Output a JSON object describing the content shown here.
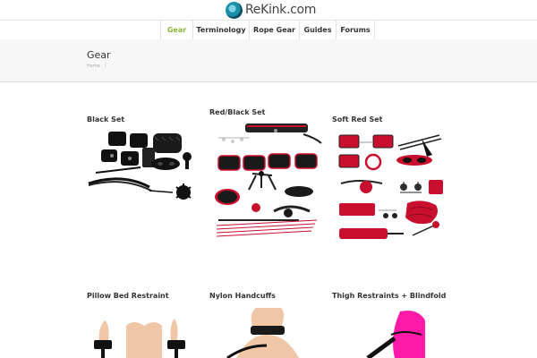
{
  "brand": {
    "name": "ReKink.com"
  },
  "nav": [
    {
      "label": "Gear",
      "active": true
    },
    {
      "label": "Terminology"
    },
    {
      "label": "Rope Gear"
    },
    {
      "label": "Guides"
    },
    {
      "label": "Forums"
    }
  ],
  "page": {
    "title": "Gear",
    "breadcrumb": "Home"
  },
  "products": [
    {
      "title": "Black Set"
    },
    {
      "title": "Red/Black Set"
    },
    {
      "title": "Soft Red Set"
    },
    {
      "title": "Pillow Bed Restraint"
    },
    {
      "title": "Nylon Handcuffs"
    },
    {
      "title": "Thigh Restraints + Blindfold"
    }
  ],
  "colors": {
    "accent": "#8cb43b",
    "red": "#c8102e",
    "pink": "#ff1aa8",
    "skin": "#f0c7a6"
  }
}
